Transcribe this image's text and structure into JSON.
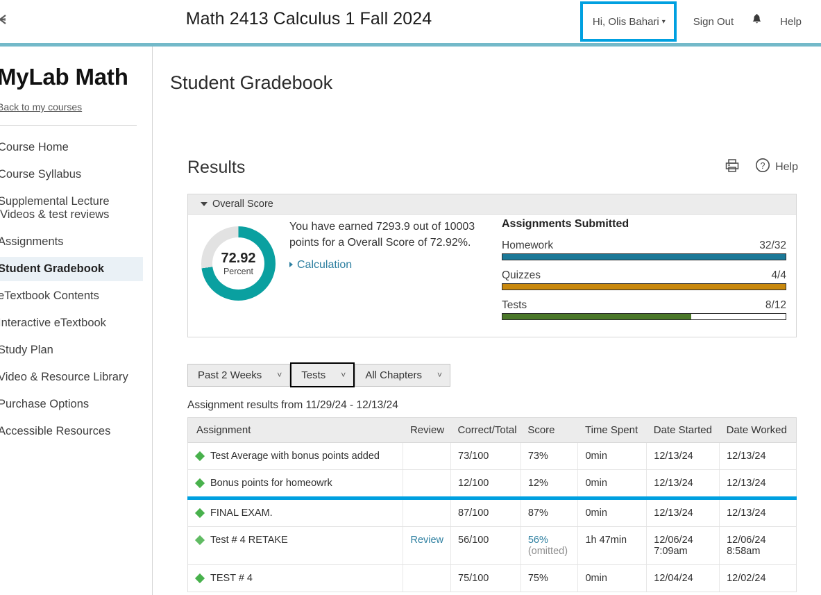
{
  "header": {
    "course_title": "Math 2413 Calculus 1 Fall 2024",
    "collapse_icon": "collapse-panel-icon",
    "user_menu": "Hi, Olis Bahari",
    "sign_out": "Sign Out",
    "bell_icon": "notification-bell-icon",
    "help": "Help"
  },
  "sidebar": {
    "brand": "MyLab Math",
    "back_link": "Back to my courses",
    "items": [
      {
        "label": "Course Home",
        "active": false
      },
      {
        "label": "Course Syllabus",
        "active": false
      },
      {
        "label": "Supplemental Lecture Videos & test reviews",
        "active": false
      },
      {
        "label": "Assignments",
        "active": false
      },
      {
        "label": "Student Gradebook",
        "active": true
      },
      {
        "label": "eTextbook Contents",
        "active": false
      },
      {
        "label": "Interactive eTextbook",
        "active": false
      },
      {
        "label": "Study Plan",
        "active": false
      },
      {
        "label": "Video & Resource Library",
        "active": false
      },
      {
        "label": "Purchase Options",
        "active": false
      },
      {
        "label": "Accessible Resources",
        "active": false
      }
    ]
  },
  "main": {
    "page_title": "Student Gradebook",
    "results_heading": "Results",
    "print_icon": "printer-icon",
    "help_icon": "question-circle-icon",
    "help_label": "Help"
  },
  "overall_score": {
    "section_title": "Overall Score",
    "donut_value": "72.92",
    "donut_unit": "Percent",
    "donut_percent": 72.92,
    "summary_text": "You have earned 7293.9 out of 10003 points for a Overall Score of 72.92%.",
    "calculation_link": "Calculation",
    "submitted_title": "Assignments Submitted",
    "bars": [
      {
        "label": "Homework",
        "value": "32/32",
        "percent": 100,
        "color": "#1b7897"
      },
      {
        "label": "Quizzes",
        "value": "4/4",
        "percent": 100,
        "color": "#c8880d"
      },
      {
        "label": "Tests",
        "value": "8/12",
        "percent": 66.7,
        "color": "#4a7729"
      }
    ]
  },
  "filters": [
    {
      "label": "Past 2 Weeks",
      "focused": false
    },
    {
      "label": "Tests",
      "focused": true
    },
    {
      "label": "All Chapters",
      "focused": false
    }
  ],
  "results_range": "Assignment results from 11/29/24 - 12/13/24",
  "table": {
    "columns": [
      "Assignment",
      "Review",
      "Correct/Total",
      "Score",
      "Time Spent",
      "Date Started",
      "Date Worked"
    ],
    "rows": [
      {
        "assignment": "Test Average with bonus points added",
        "review": "",
        "correct_total": "73/100",
        "score": "73%",
        "score_note": "",
        "time_spent": "0min",
        "date_started": "12/13/24",
        "date_started_time": "",
        "date_worked": "12/13/24",
        "date_worked_time": "",
        "dim": false,
        "highlighted": false
      },
      {
        "assignment": "Bonus points for homeowrk",
        "review": "",
        "correct_total": "12/100",
        "score": "12%",
        "score_note": "",
        "time_spent": "0min",
        "date_started": "12/13/24",
        "date_started_time": "",
        "date_worked": "12/13/24",
        "date_worked_time": "",
        "dim": false,
        "highlighted": false
      },
      {
        "assignment": "FINAL EXAM.",
        "review": "",
        "correct_total": "87/100",
        "score": "87%",
        "score_note": "",
        "time_spent": "0min",
        "date_started": "12/13/24",
        "date_started_time": "",
        "date_worked": "12/13/24",
        "date_worked_time": "",
        "dim": false,
        "highlighted": true
      },
      {
        "assignment": "Test # 4 RETAKE",
        "review": "Review",
        "correct_total": "56/100",
        "score": "56%",
        "score_note": "(omitted)",
        "time_spent": "1h 47min",
        "date_started": "12/06/24",
        "date_started_time": "7:09am",
        "date_worked": "12/06/24",
        "date_worked_time": "8:58am",
        "dim": true,
        "highlighted": false
      },
      {
        "assignment": "TEST # 4",
        "review": "",
        "correct_total": "75/100",
        "score": "75%",
        "score_note": "",
        "time_spent": "0min",
        "date_started": "12/04/24",
        "date_started_time": "",
        "date_worked": "12/02/24",
        "date_worked_time": "",
        "dim": false,
        "highlighted": false
      }
    ]
  },
  "colors": {
    "accent_teal": "#0aa0a0",
    "highlight_blue": "#00a0e0",
    "header_rule": "#73b9c9",
    "link": "#2d7fa0",
    "diamond_green": "#48b14c"
  }
}
